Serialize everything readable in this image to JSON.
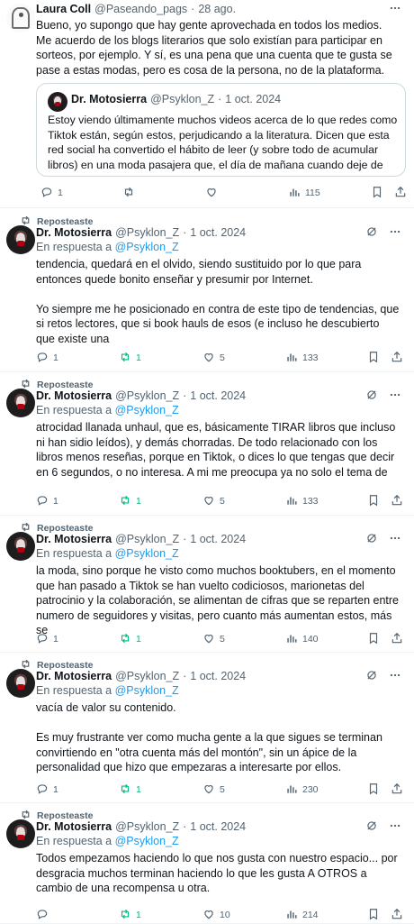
{
  "tweets": [
    {
      "name": "Laura Coll",
      "handle": "@Paseando_pags",
      "date": "28 ago.",
      "text": "Bueno, yo supongo que hay gente aprovechada en todos los medios. Me acuerdo de los blogs literarios que solo existían para participar en sorteos, por ejemplo. Y sí, es una pena que una cuenta que te gusta se pase a estas modas, pero es cosa de la persona, no de la plataforma.",
      "quote": {
        "name": "Dr. Motosierra",
        "handle": "@Psyklon_Z",
        "date": "1 oct. 2024",
        "text": "Estoy viendo últimamente muchos videos acerca de lo que redes como Tiktok están, según estos, perjudicando a la literatura. Dicen que esta red social ha convertido el hábito de leer (y sobre todo de acumular libros) en una moda pasajera que, el día de mañana cuando deje de ser"
      },
      "replies": "1",
      "retweets": "",
      "likes": "",
      "views": "115"
    },
    {
      "repost": "Reposteaste",
      "name": "Dr. Motosierra",
      "handle": "@Psyklon_Z",
      "date": "1 oct. 2024",
      "reply_prefix": "En respuesta a",
      "reply_to": "@Psyklon_Z",
      "text": "tendencia, quedará en el olvido, siendo sustituido por lo que para entonces quede bonito enseñar y presumir por Internet.\n\nYo siempre me he posicionado en contra de este tipo de tendencias, que si retos lectores, que si book hauls de esos (e incluso he descubierto que existe una",
      "replies": "1",
      "retweets": "1",
      "likes": "5",
      "views": "133"
    },
    {
      "repost": "Reposteaste",
      "name": "Dr. Motosierra",
      "handle": "@Psyklon_Z",
      "date": "1 oct. 2024",
      "reply_prefix": "En respuesta a",
      "reply_to": "@Psyklon_Z",
      "text": "atrocidad llanada unhaul, que es, básicamente TIRAR libros que incluso ni han sidio leídos), y demás chorradas. De todo relacionado con los libros menos reseñas, porque en Tiktok, o dices lo que tengas que decir en 6 segundos, o no interesa. A mi me preocupa ya no solo el tema de",
      "replies": "1",
      "retweets": "1",
      "likes": "5",
      "views": "133"
    },
    {
      "repost": "Reposteaste",
      "name": "Dr. Motosierra",
      "handle": "@Psyklon_Z",
      "date": "1 oct. 2024",
      "reply_prefix": "En respuesta a",
      "reply_to": "@Psyklon_Z",
      "text": "la moda, sino porque he visto como muchos booktubers, en el momento que han pasado a Tiktok se han vuelto codiciosos, marionetas del patrocinio y la colaboración, se alimentan de cifras que se reparten entre numero de seguidores y visitas, pero cuanto más aumentan estos, más se",
      "replies": "1",
      "retweets": "1",
      "likes": "5",
      "views": "140"
    },
    {
      "repost": "Reposteaste",
      "name": "Dr. Motosierra",
      "handle": "@Psyklon_Z",
      "date": "1 oct. 2024",
      "reply_prefix": "En respuesta a",
      "reply_to": "@Psyklon_Z",
      "text": "vacía de valor su contenido.\n\nEs muy frustrante ver como mucha gente a la que sigues se terminan convirtiendo en \"otra cuenta más del montón\", sin un ápice de la personalidad que hizo que empezaras a interesarte por ellos.",
      "replies": "1",
      "retweets": "1",
      "likes": "5",
      "views": "230"
    },
    {
      "repost": "Reposteaste",
      "name": "Dr. Motosierra",
      "handle": "@Psyklon_Z",
      "date": "1 oct. 2024",
      "reply_prefix": "En respuesta a",
      "reply_to": "@Psyklon_Z",
      "text": "Todos empezamos haciendo lo que nos gusta con nuestro espacio... por desgracia muchos terminan haciendo lo que les gusta A OTROS a cambio de una recompensa u otra.",
      "replies": "",
      "retweets": "1",
      "likes": "10",
      "views": "214"
    }
  ],
  "colors": {
    "accent": "#1d9bf0",
    "retweet_active": "#00ba7c",
    "muted": "#536471"
  },
  "icons": [
    "reply-icon",
    "retweet-icon",
    "like-icon",
    "views-icon",
    "bookmark-icon",
    "share-icon",
    "grok-icon",
    "more-icon",
    "repost-icon"
  ]
}
